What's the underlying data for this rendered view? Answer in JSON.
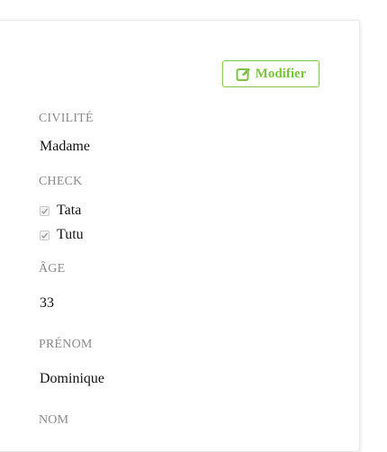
{
  "actions": {
    "edit_label": "Modifier",
    "edit_icon": "edit-icon",
    "accent_color": "#7cc142"
  },
  "fields": {
    "civilite": {
      "label": "CIVILITÉ",
      "value": "Madame"
    },
    "check": {
      "label": "CHECK",
      "options": [
        {
          "label": "Tata",
          "checked": true
        },
        {
          "label": "Tutu",
          "checked": true
        }
      ]
    },
    "age": {
      "label": "ÂGE",
      "value": "33"
    },
    "prenom": {
      "label": "PRÉNOM",
      "value": "Dominique"
    },
    "nom": {
      "label": "NOM"
    }
  }
}
